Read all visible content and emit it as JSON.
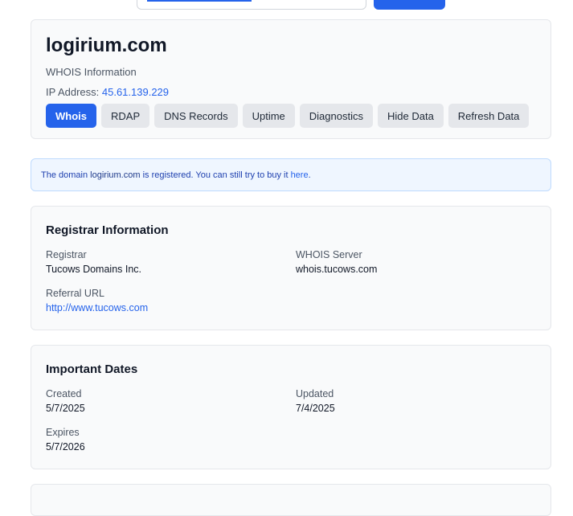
{
  "header": {
    "domain": "logirium.com",
    "subtitle": "WHOIS Information",
    "ip_label": "IP Address:",
    "ip_value": "45.61.139.229",
    "tabs": [
      {
        "label": "Whois",
        "active": true
      },
      {
        "label": "RDAP"
      },
      {
        "label": "DNS Records"
      },
      {
        "label": "Uptime"
      },
      {
        "label": "Diagnostics"
      },
      {
        "label": "Hide Data"
      },
      {
        "label": "Refresh Data"
      }
    ]
  },
  "alert": {
    "prefix": "The domain",
    "domain": "logirium.com",
    "middle": "is registered. You can still try to buy it",
    "link": "here",
    "suffix": "."
  },
  "registrar": {
    "title": "Registrar Information",
    "registrar_label": "Registrar",
    "registrar_value": "Tucows Domains Inc.",
    "whois_server_label": "WHOIS Server",
    "whois_server_value": "whois.tucows.com",
    "referral_label": "Referral URL",
    "referral_value": "http://www.tucows.com"
  },
  "dates": {
    "title": "Important Dates",
    "created_label": "Created",
    "created_value": "5/7/2025",
    "updated_label": "Updated",
    "updated_value": "7/4/2025",
    "expires_label": "Expires",
    "expires_value": "5/7/2026"
  },
  "colors": {
    "accent": "#2563eb",
    "card_bg": "#f9fafb",
    "alert_bg": "#eff6ff"
  }
}
